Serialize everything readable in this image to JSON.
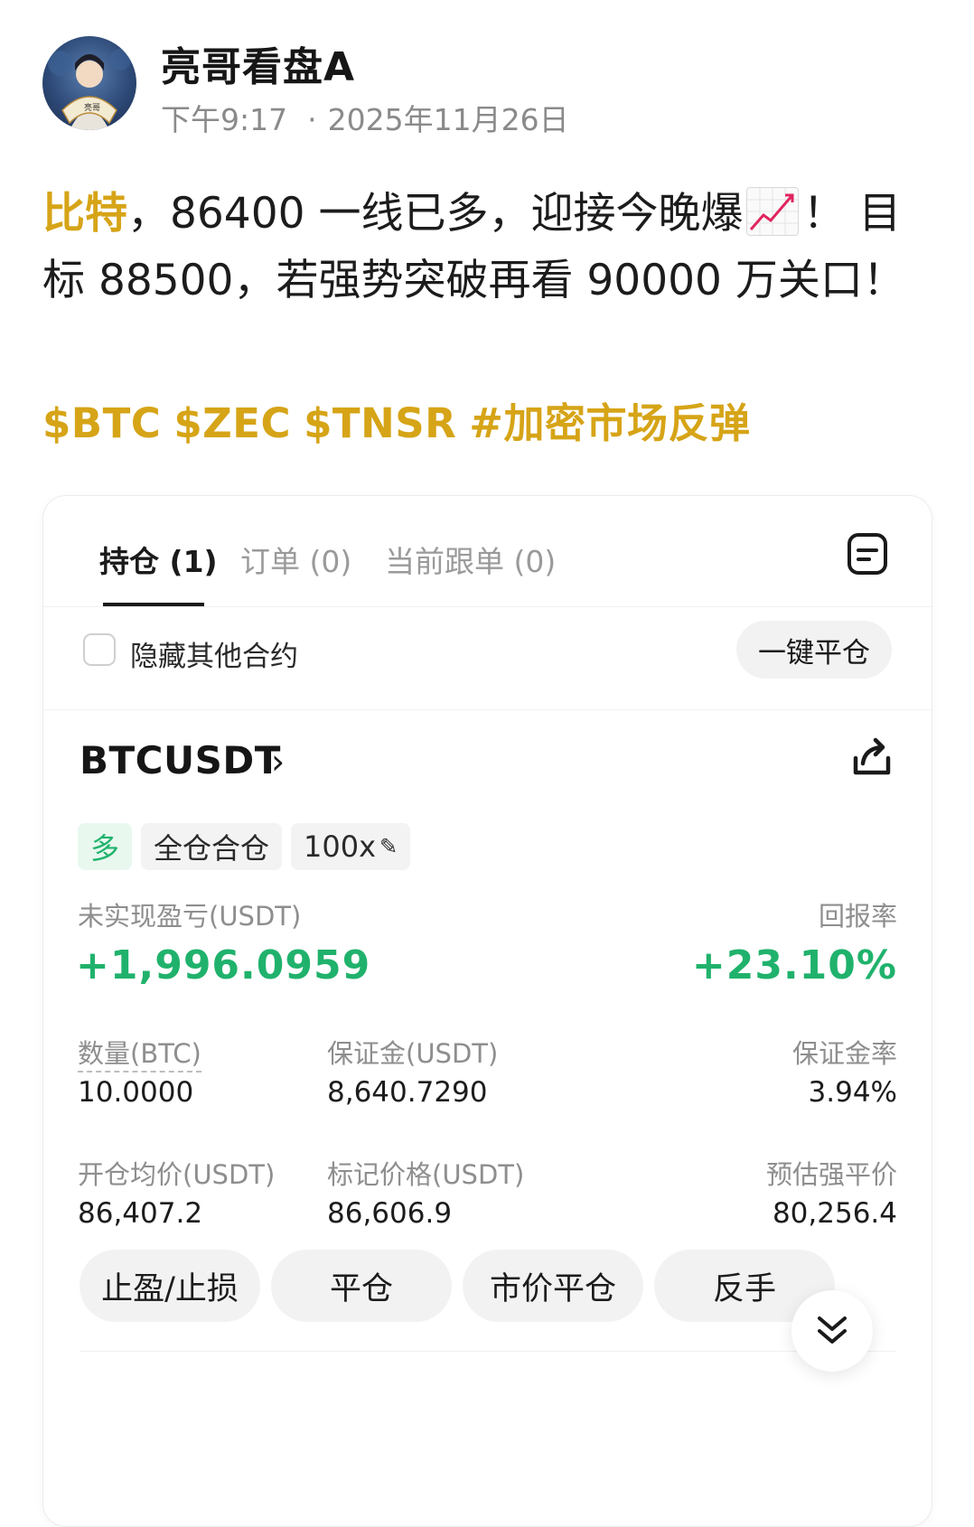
{
  "post": {
    "author": "亮哥看盘A",
    "time": "下午9:17",
    "date": "2025年11月26日",
    "separator": "·",
    "highlight_word": "比特",
    "text_part1": "，86400 一线已多，迎接今晚爆",
    "text_part2": "！ 目标 88500，若强势突破再看 90000 万关口！",
    "tags": [
      "$BTC",
      "$ZEC",
      "$TNSR",
      "#加密市场反弹"
    ],
    "accent_color": "#d6a417"
  },
  "card": {
    "tabs": [
      {
        "label": "持仓 (1)",
        "active": true
      },
      {
        "label": "订单 (0)",
        "active": false
      },
      {
        "label": "当前跟单 (0)",
        "active": false
      }
    ],
    "hide_others_label": "隐藏其他合约",
    "close_all_label": "一键平仓",
    "symbol": "BTCUSDT",
    "badges": {
      "side": "多",
      "margin_mode": "全仓合仓",
      "leverage": "100x"
    },
    "unrealized_pnl_label": "未实现盈亏(USDT)",
    "unrealized_pnl": "+1,996.0959",
    "roe_label": "回报率",
    "roe": "+23.10%",
    "qty_label": "数量(BTC)",
    "qty": "10.0000",
    "margin_label": "保证金(USDT)",
    "margin": "8,640.7290",
    "margin_ratio_label": "保证金率",
    "margin_ratio": "3.94%",
    "entry_label": "开仓均价(USDT)",
    "entry": "86,407.2",
    "mark_label": "标记价格(USDT)",
    "mark": "86,606.9",
    "liq_label": "预估强平价",
    "liq": "80,256.4",
    "actions": [
      "止盈/止损",
      "平仓",
      "市价平仓",
      "反手"
    ],
    "profit_color": "#20b26c"
  }
}
